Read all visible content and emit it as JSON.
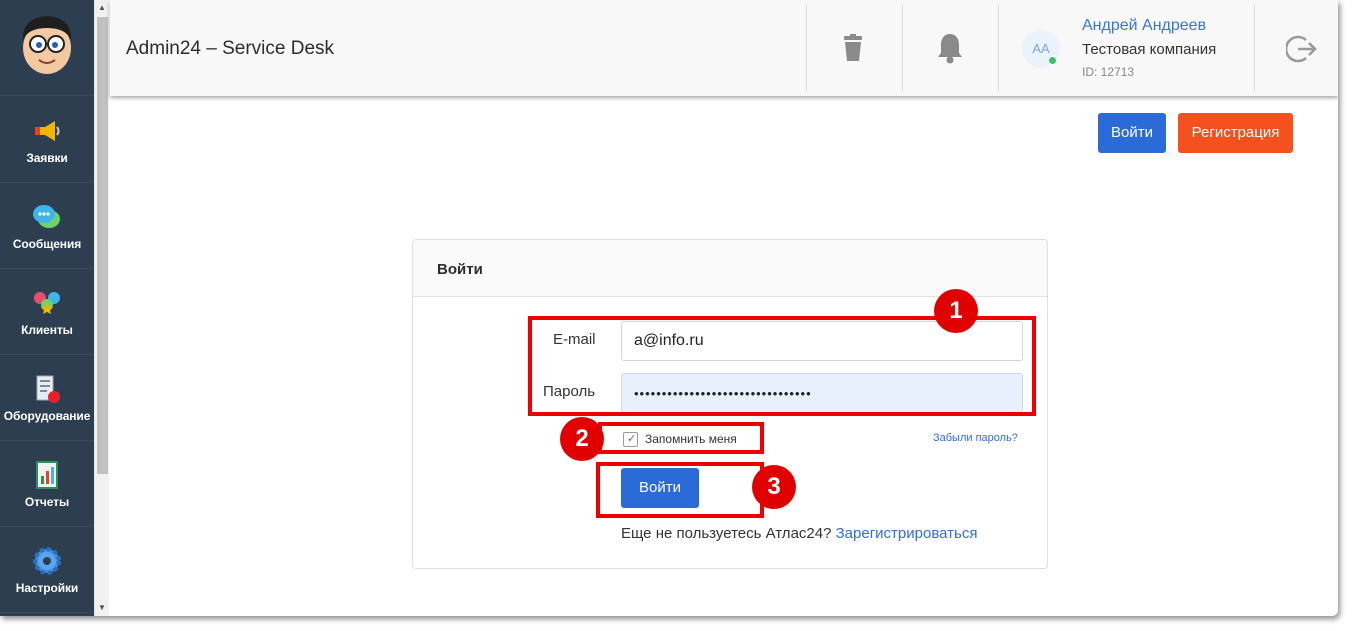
{
  "sidebar": {
    "items": [
      {
        "label": "Заявки",
        "icon": "megaphone-icon"
      },
      {
        "label": "Сообщения",
        "icon": "chat-bubble-icon"
      },
      {
        "label": "Клиенты",
        "icon": "clients-icon"
      },
      {
        "label": "Оборудование",
        "icon": "equipment-icon"
      },
      {
        "label": "Отчеты",
        "icon": "report-chart-icon"
      },
      {
        "label": "Настройки",
        "icon": "gear-icon"
      }
    ]
  },
  "header": {
    "title": "Admin24 – Service Desk",
    "user": {
      "initials": "AA",
      "name": "Андрей Андреев",
      "company": "Тестовая компания",
      "id": "ID: 12713",
      "status_color": "#36c46b"
    }
  },
  "top_actions": {
    "login_label": "Войти",
    "register_label": "Регистрация"
  },
  "login_form": {
    "title": "Войти",
    "email_label": "E-mail",
    "email_value": "a@info.ru",
    "password_label": "Пароль",
    "password_value": "••••••••••••••••••••••••••••••••",
    "remember_label": "Запомнить меня",
    "remember_checked": true,
    "forgot_label": "Забыли пароль?",
    "submit_label": "Войти",
    "register_prompt": "Еще не пользуетесь Атлас24?",
    "register_link": "Зарегистрироваться"
  },
  "annotations": [
    "1",
    "2",
    "3"
  ],
  "colors": {
    "sidebar_bg": "#2c3e50",
    "primary": "#2a6bd8",
    "register": "#f4511e",
    "annotation": "#e00000"
  }
}
